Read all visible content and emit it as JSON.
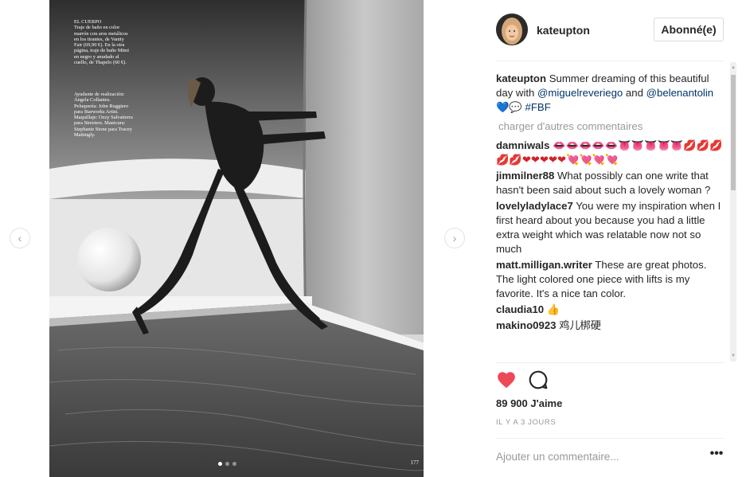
{
  "post": {
    "username": "kateupton",
    "follow_label": "Abonné(e)",
    "caption": {
      "username": "kateupton",
      "text_before": "Summer dreaming of this beautiful day with ",
      "mention1": "@miguelreveriego",
      "text_mid": " and ",
      "mention2": "@belenantolin",
      "text_after": " ",
      "hashtag": "#FBF"
    },
    "load_more": "charger d'autres commentaires",
    "comments": [
      {
        "username": "damniwals",
        "text": "👄👄👄👄👄👅👅👅👅👅💋💋💋💋💋❤❤❤❤❤💘💘💘💘"
      },
      {
        "username": "jimmilner88",
        "text": "What possibly can one write that hasn't been said about such a lovely woman ?"
      },
      {
        "username": "lovelyladylace7",
        "text": "You were my inspiration when I first heard about you because you had a little extra weight which was relatable now not so much"
      },
      {
        "username": "matt.milligan.writer",
        "text": "These are great photos. The light colored one piece with lifts is my favorite. It's a nice tan color."
      },
      {
        "username": "claudia10",
        "text": "👍"
      },
      {
        "username": "makino0923",
        "text": "鸡儿梆硬"
      }
    ],
    "likes_count": "89 900",
    "likes_label": "J'aime",
    "timestamp": "IL Y A 3 JOURS",
    "add_comment_placeholder": "Ajouter un commentaire...",
    "more_label": "•••"
  },
  "magazine": {
    "caption": "EL CUERPO\nTraje de baño en color marrón con aros metálicos en los tirantes, de Vanity Fair (69,90 €). En la otra página, traje de baño Mimi en negro y anudado al cuello, de Thapelo (60 €).",
    "credits": "Ayudante de realización: Ángela Collantes. Peluquería: John Ruggiero para Starworks Artist. Maquillaje: Ozzy Salvatierra para Streeters. Manicura: Stephanie Stone para Tracey Mattingly.",
    "page_number": "177"
  },
  "icons": {
    "like": "heart-filled-icon",
    "comment": "comment-bubble-icon",
    "prev": "chevron-left-icon",
    "next": "chevron-right-icon",
    "more": "ellipsis-icon"
  },
  "colors": {
    "like_red": "#ed4956",
    "link_blue": "#003569",
    "muted_gray": "#999999",
    "border": "#dbdbdb"
  }
}
